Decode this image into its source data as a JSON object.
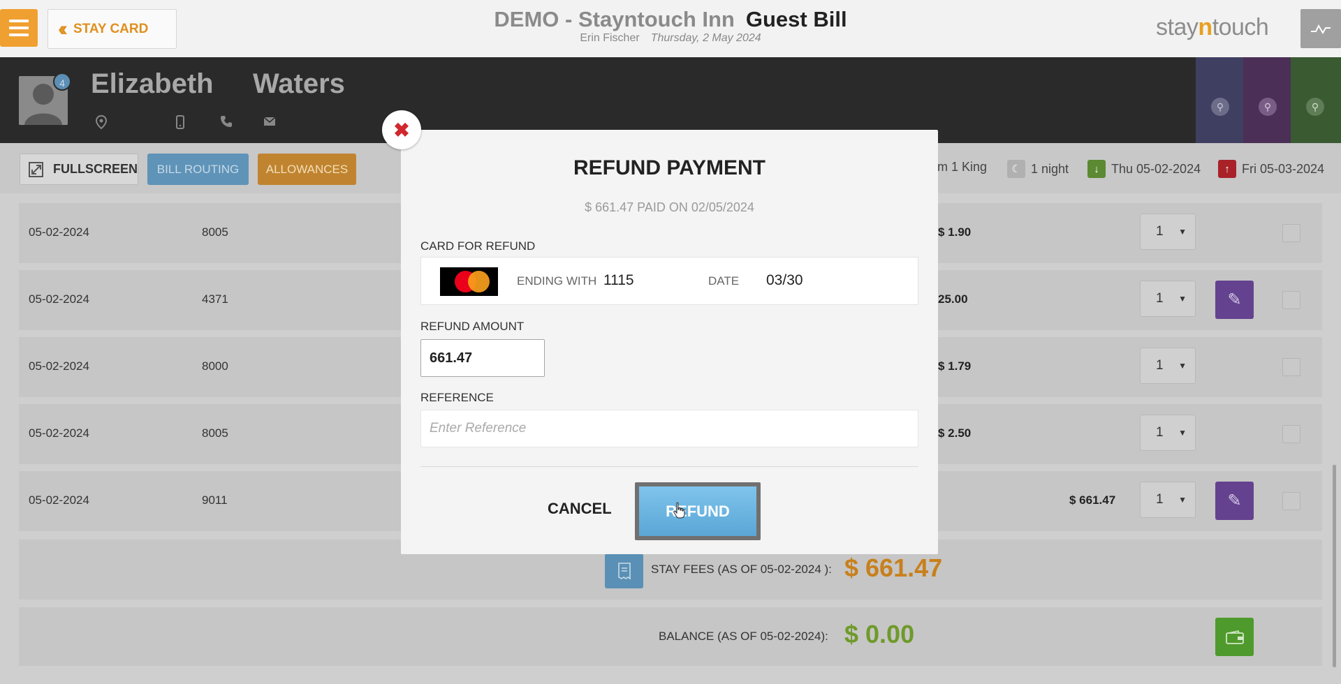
{
  "header": {
    "stay_card_label": "STAY CARD",
    "hotel_name": "DEMO - Stayntouch Inn",
    "page_title": "Guest Bill",
    "user": "Erin Fischer",
    "date": "Thursday, 2 May 2024",
    "logo_prefix": "stay",
    "logo_accent": "n",
    "logo_suffix": "touch"
  },
  "guest": {
    "first_name": "Elizabeth",
    "last_name": "Waters",
    "badge_count": "4"
  },
  "toolbar": {
    "fullscreen_label": "FULLSCREEN",
    "bill_routing_label": "BILL ROUTING",
    "allowances_label": "ALLOWANCES",
    "room_type": "m 1 King",
    "nights": "1 night",
    "arrival": "Thu 05-02-2024",
    "departure": "Fri 05-03-2024"
  },
  "rows": [
    {
      "date": "05-02-2024",
      "code": "8005",
      "amount": "$ 1.90",
      "qty": "1",
      "editable": false
    },
    {
      "date": "05-02-2024",
      "code": "4371",
      "amount": "25.00",
      "qty": "1",
      "editable": true
    },
    {
      "date": "05-02-2024",
      "code": "8000",
      "amount": "$ 1.79",
      "qty": "1",
      "editable": false
    },
    {
      "date": "05-02-2024",
      "code": "8005",
      "amount": "$ 2.50",
      "qty": "1",
      "editable": false
    },
    {
      "date": "05-02-2024",
      "code": "9011",
      "amount": "$ 661.47",
      "qty": "1",
      "editable": true
    }
  ],
  "summary": {
    "stay_fees_label": "STAY FEES (AS OF  05-02-2024 ):",
    "stay_fees_value": "$ 661.47",
    "balance_label": "BALANCE (AS OF  05-02-2024):",
    "balance_value": "$ 0.00"
  },
  "modal": {
    "title": "REFUND PAYMENT",
    "subtitle": "$ 661.47 PAID ON 02/05/2024",
    "card_label": "CARD FOR REFUND",
    "ending_label": "ENDING WITH",
    "ending_value": "1115",
    "date_label": "DATE",
    "date_value": "03/30",
    "amount_label": "REFUND AMOUNT",
    "amount_value": "661.47",
    "reference_label": "REFERENCE",
    "reference_placeholder": "Enter Reference",
    "reference_value": "",
    "cancel_label": "CANCEL",
    "refund_label": "REFUND"
  },
  "colors": {
    "accent_orange": "#f0a030",
    "purple": "#64428f",
    "blue": "#5aa6d6",
    "fees_orange": "#c8801c",
    "balance_green": "#6f9a2a",
    "close_red": "#d0282e"
  },
  "icons": {
    "menu": "hamburger-icon",
    "back": "double-chevron-left-icon",
    "graph": "graph-icon",
    "location": "location-pin-icon",
    "mobile": "mobile-icon",
    "phone": "phone-icon",
    "email": "email-icon",
    "edit": "pencil-icon",
    "wallet": "wallet-icon",
    "receipt": "receipt-icon",
    "close": "close-icon"
  }
}
